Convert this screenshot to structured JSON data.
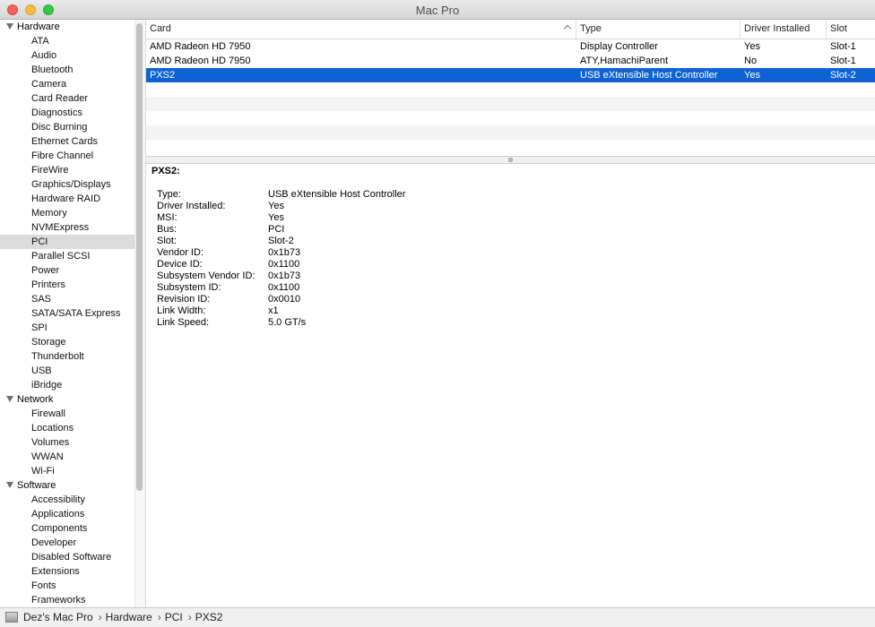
{
  "window": {
    "title": "Mac Pro"
  },
  "sidebar": {
    "groups": [
      {
        "label": "Hardware",
        "items": [
          "ATA",
          "Audio",
          "Bluetooth",
          "Camera",
          "Card Reader",
          "Diagnostics",
          "Disc Burning",
          "Ethernet Cards",
          "Fibre Channel",
          "FireWire",
          "Graphics/Displays",
          "Hardware RAID",
          "Memory",
          "NVMExpress",
          "PCI",
          "Parallel SCSI",
          "Power",
          "Printers",
          "SAS",
          "SATA/SATA Express",
          "SPI",
          "Storage",
          "Thunderbolt",
          "USB",
          "iBridge"
        ]
      },
      {
        "label": "Network",
        "items": [
          "Firewall",
          "Locations",
          "Volumes",
          "WWAN",
          "Wi-Fi"
        ]
      },
      {
        "label": "Software",
        "items": [
          "Accessibility",
          "Applications",
          "Components",
          "Developer",
          "Disabled Software",
          "Extensions",
          "Fonts",
          "Frameworks"
        ]
      }
    ],
    "selected": "PCI"
  },
  "table": {
    "columns": [
      "Card",
      "Type",
      "Driver Installed",
      "Slot"
    ],
    "rows": [
      [
        "AMD Radeon HD 7950",
        "Display Controller",
        "Yes",
        "Slot-1"
      ],
      [
        "AMD Radeon HD 7950",
        "ATY,HamachiParent",
        "No",
        "Slot-1"
      ],
      [
        "PXS2",
        "USB eXtensible Host Controller",
        "Yes",
        "Slot-2"
      ]
    ],
    "selected_row": 2
  },
  "detail": {
    "title": "PXS2:",
    "fields": [
      {
        "key": "Type:",
        "value": "USB eXtensible Host Controller"
      },
      {
        "key": "Driver Installed:",
        "value": "Yes"
      },
      {
        "key": "MSI:",
        "value": "Yes"
      },
      {
        "key": "Bus:",
        "value": "PCI"
      },
      {
        "key": "Slot:",
        "value": "Slot-2"
      },
      {
        "key": "Vendor ID:",
        "value": "0x1b73"
      },
      {
        "key": "Device ID:",
        "value": "0x1100"
      },
      {
        "key": "Subsystem Vendor ID:",
        "value": "0x1b73"
      },
      {
        "key": "Subsystem ID:",
        "value": "0x1100"
      },
      {
        "key": "Revision ID:",
        "value": "0x0010"
      },
      {
        "key": "Link Width:",
        "value": "x1"
      },
      {
        "key": "Link Speed:",
        "value": "5.0 GT/s"
      }
    ]
  },
  "pathbar": {
    "icon": "computer-icon",
    "crumbs": [
      "Dez's Mac Pro",
      "Hardware",
      "PCI",
      "PXS2"
    ]
  },
  "colors": {
    "selection": "#0e63d4",
    "sidebar_selection": "#dcdcdc"
  }
}
